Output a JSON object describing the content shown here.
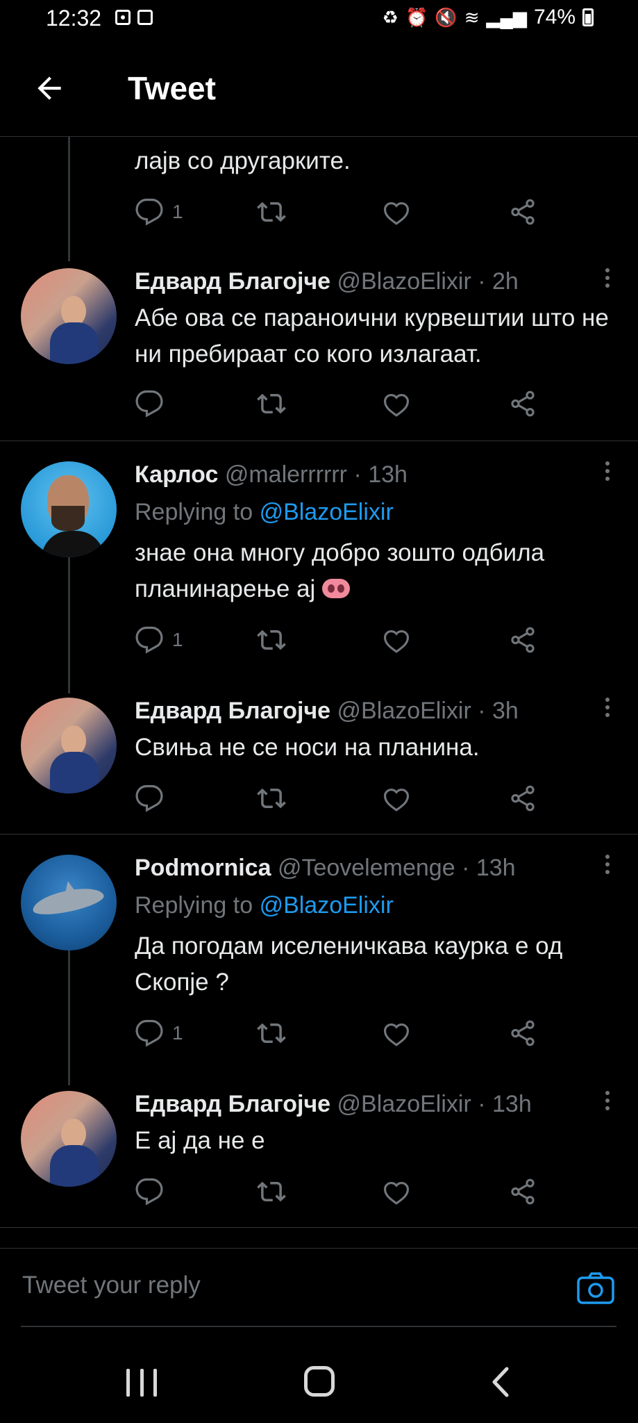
{
  "status_bar": {
    "time": "12:32",
    "battery": "74%",
    "left_icons": [
      "screenshot-icon",
      "gallery-icon"
    ],
    "right_icons": [
      "recycle-icon",
      "alarm-icon",
      "mute-icon",
      "wifi-icon",
      "signal-icon",
      "battery-icon"
    ]
  },
  "header": {
    "title": "Tweet",
    "back_icon": "back-arrow-icon"
  },
  "thread": [
    {
      "id": "partial",
      "text": "лајв со другарките.",
      "reply_count": "1"
    },
    {
      "id": "t1",
      "name": "Едвард Благојче",
      "handle": "@BlazoElixir",
      "time": "· 2h",
      "text": "Абе ова се параноични курвештии што не ни пребираат со кого излагаат.",
      "reply_count": ""
    },
    {
      "id": "t2",
      "name": "Карлос",
      "handle": "@malerrrrrr",
      "time": "· 13h",
      "replying_prefix": "Replying to",
      "replying_to": "@BlazoElixir",
      "text": "знае она многу добро зошто одбила планинарење ај",
      "reply_count": "1"
    },
    {
      "id": "t3",
      "name": "Едвард Благојче",
      "handle": "@BlazoElixir",
      "time": "· 3h",
      "text": "Свиња не се носи на планина.",
      "reply_count": ""
    },
    {
      "id": "t4",
      "name": "Podmornica",
      "handle": "@Teovelemenge",
      "time": "· 13h",
      "replying_prefix": "Replying to",
      "replying_to": "@BlazoElixir",
      "text": "Да погодам иселеничкава каурка е од Скопје ?",
      "reply_count": "1"
    },
    {
      "id": "t5",
      "name": "Едвард Благојче",
      "handle": "@BlazoElixir",
      "time": "· 13h",
      "text": "Е ај да не е",
      "reply_count": ""
    }
  ],
  "reply_bar": {
    "placeholder": "Tweet your reply",
    "camera_icon": "camera-icon"
  },
  "colors": {
    "background": "#000000",
    "text": "#e7e9ea",
    "secondary": "#71767b",
    "accent": "#1d9bf0",
    "divider": "#2f3336"
  }
}
